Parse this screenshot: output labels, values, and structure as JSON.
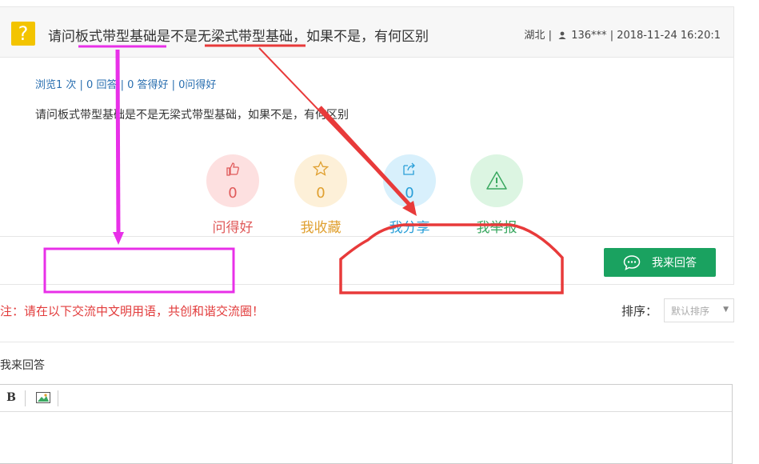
{
  "question": {
    "title": "请问板式带型基础是不是无梁式带型基础，如果不是，有何区别",
    "location": "湖北",
    "user": "136***",
    "datetime": "2018-11-24 16:20:1",
    "stats": "浏览1 次 | 0 回答 | 0 答得好 | 0问得好",
    "body": "请问板式带型基础是不是无梁式带型基础，如果不是，有何区别"
  },
  "actions": [
    {
      "label": "问得好",
      "count": "0",
      "icon": "thumbs-up-icon",
      "color": "#e05a5a",
      "bg": "#fde0e0"
    },
    {
      "label": "我收藏",
      "count": "0",
      "icon": "star-icon",
      "color": "#e0a030",
      "bg": "#fdf0d8"
    },
    {
      "label": "我分享",
      "count": "0",
      "icon": "share-icon",
      "color": "#2a9fd8",
      "bg": "#d8f0fc"
    },
    {
      "label": "我举报",
      "count": "",
      "icon": "warning-icon",
      "color": "#3aa860",
      "bg": "#dcf5e2"
    }
  ],
  "answer_button": "我来回答",
  "notice": "注：请在以下交流中文明用语，共创和谐交流圈！",
  "sort": {
    "label": "排序：",
    "value": "默认排序"
  },
  "reply_label": "我来回答",
  "editor_toolbar": {
    "bold": "B"
  },
  "colors": {
    "accent_green": "#1aa260",
    "annotation_magenta": "#e830e8",
    "annotation_red": "#e83a3a"
  }
}
